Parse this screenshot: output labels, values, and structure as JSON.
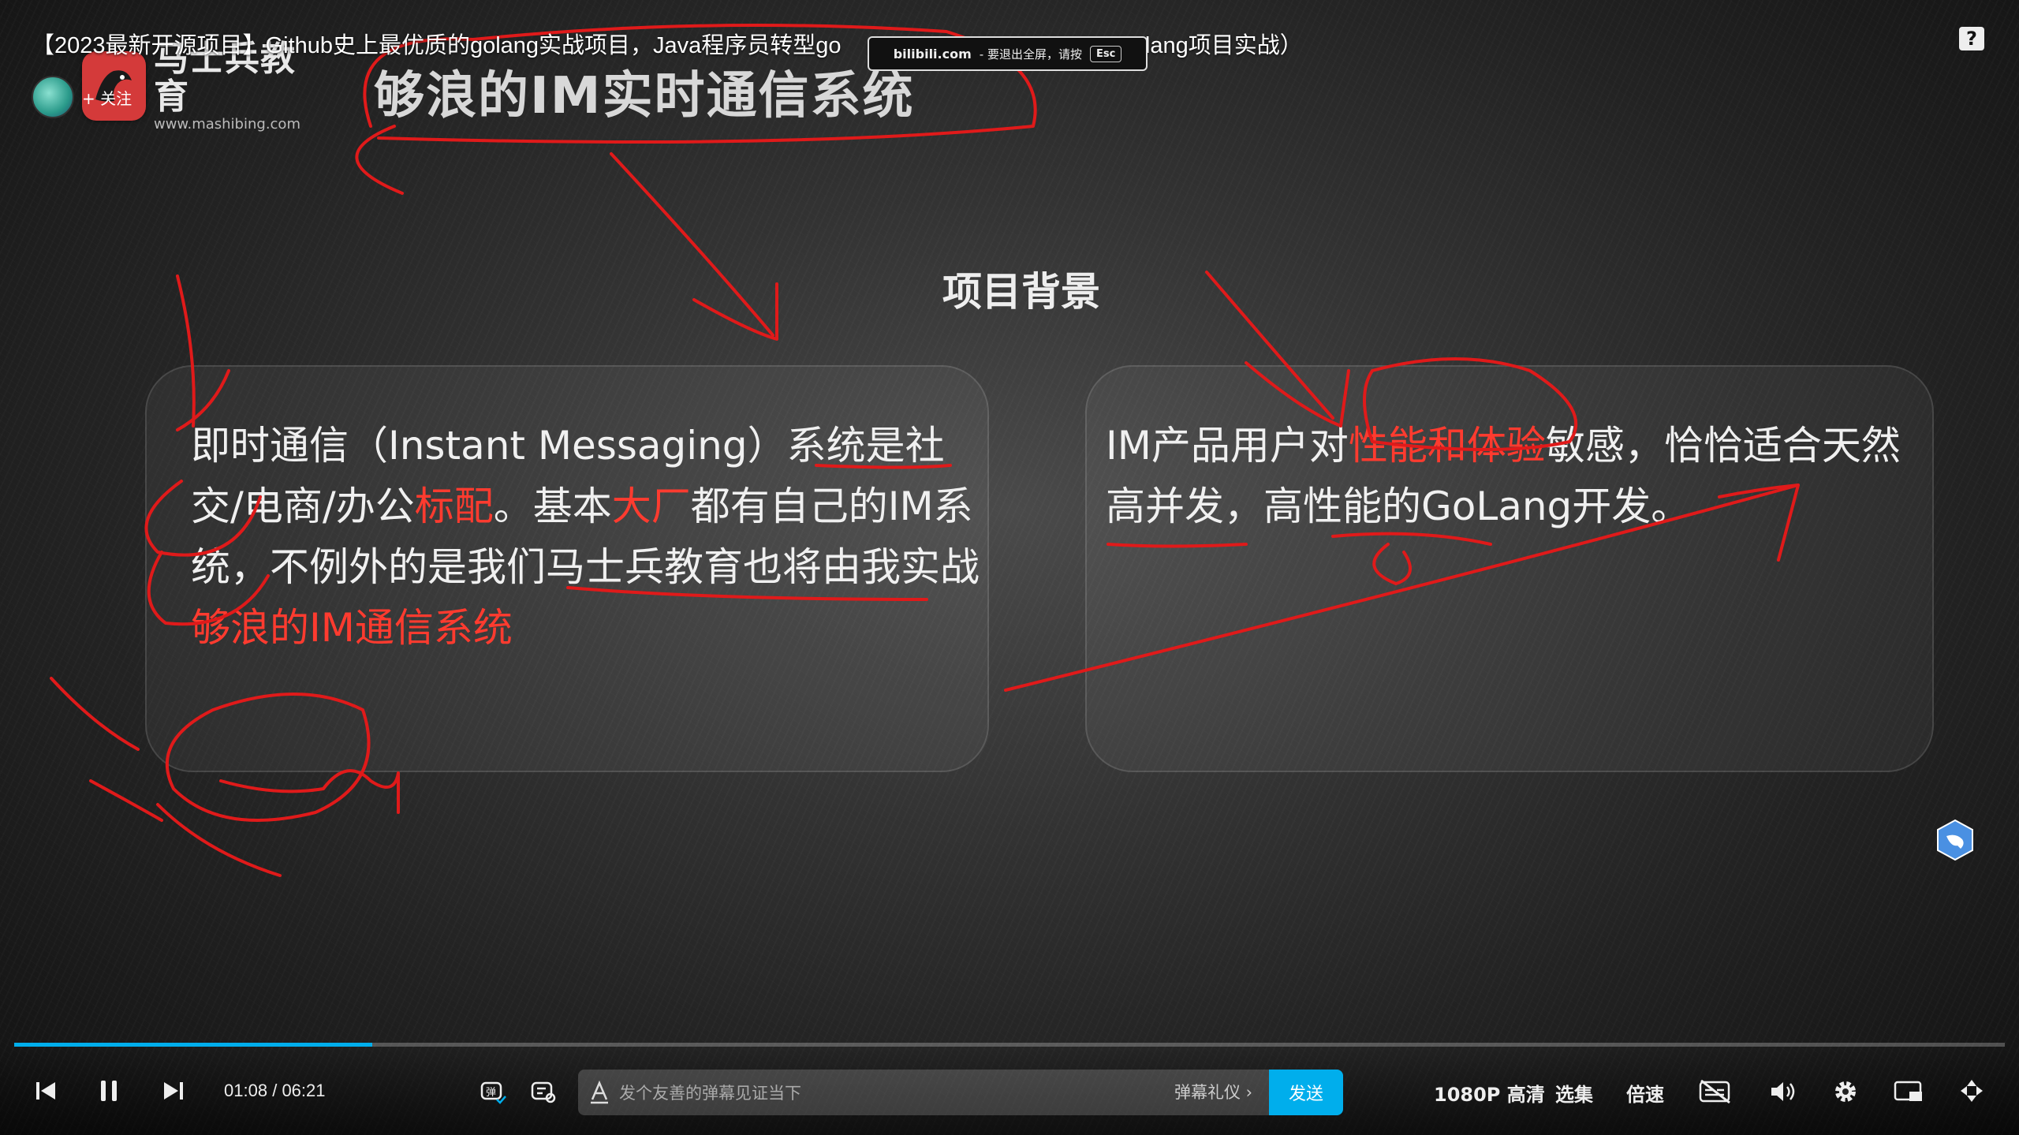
{
  "video": {
    "title": "【2023最新开源项目】Github史上最优质的golang实战项目，Java程序员转型go",
    "title_tail": "/golang项目实战）"
  },
  "fullscreen_tip": {
    "brand": "bilibili.com",
    "text": "- 要退出全屏，请按",
    "key": "Esc"
  },
  "uploader": {
    "follow_label": "+ 关注"
  },
  "logo": {
    "name": "马士兵教育",
    "url": "www.mashibing.com"
  },
  "slide": {
    "heading": "够浪的IM实时通信系统",
    "section_title": "项目背景",
    "left_card": {
      "parts": [
        {
          "text": "即时通信（Instant Messaging）系统是社交/电商/办公",
          "hl": false
        },
        {
          "text": "标配",
          "hl": true
        },
        {
          "text": "。基本",
          "hl": false
        },
        {
          "text": "大厂",
          "hl": true
        },
        {
          "text": "都有自己的IM系统，不例外的是我们马士兵教育也将由我实战",
          "hl": false
        },
        {
          "text": "够浪的IM通信系统",
          "hl": true
        }
      ]
    },
    "right_card": {
      "parts": [
        {
          "text": "IM产品用户对",
          "hl": false
        },
        {
          "text": "性能和体验",
          "hl": true
        },
        {
          "text": "敏感，恰恰适合天然高并发，高性能的GoLang开发。",
          "hl": false
        }
      ]
    }
  },
  "player": {
    "progress": 0.18,
    "current_time": "01:08",
    "separator": "/",
    "total_time": "06:21",
    "danmaku_placeholder": "发个友善的弹幕见证当下",
    "danmaku_etiquette": "弹幕礼仪 ›",
    "send_label": "发送",
    "quality_label": "1080P 高清",
    "episodes_label": "选集",
    "speed_label": "倍速"
  },
  "icons": {
    "prev": "skip-back-icon",
    "pause": "pause-icon",
    "next": "skip-forward-icon",
    "danmaku_toggle": "danmaku-toggle-icon",
    "danmaku_settings": "danmaku-settings-icon",
    "subtitle_off": "subtitle-off-icon",
    "volume": "volume-icon",
    "settings": "gear-icon",
    "pip": "picture-in-picture-icon",
    "fullscreen_exit": "fullscreen-exit-icon",
    "help": "help-icon",
    "side_bird": "bird-icon"
  },
  "colors": {
    "highlight": "#ff3b2f",
    "accent": "#00aeec",
    "annotation": "#e01a1a"
  }
}
